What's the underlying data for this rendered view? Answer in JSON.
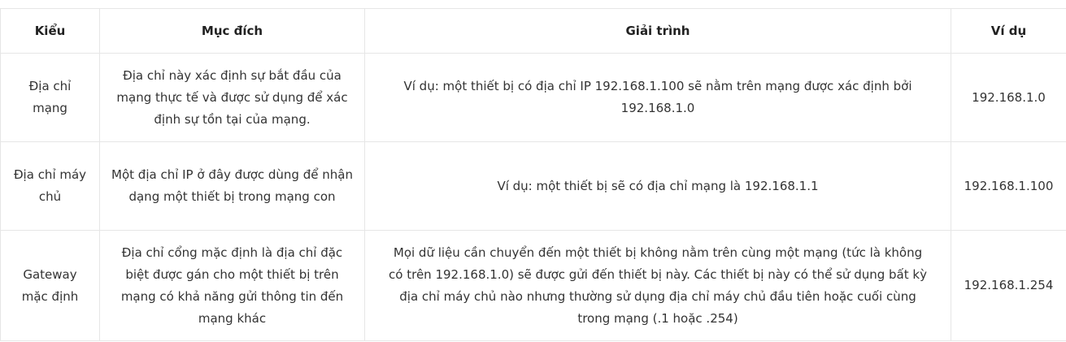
{
  "table": {
    "headers": [
      "Kiểu",
      "Mục đích",
      "Giải trình",
      "Ví dụ"
    ],
    "rows": [
      {
        "type": "Địa chỉ mạng",
        "purpose": "Địa chỉ này xác định sự bắt đầu của mạng thực tế và được sử dụng để xác định sự tồn tại của mạng.",
        "explanation": "Ví dụ: một thiết bị có địa chỉ IP 192.168.1.100 sẽ nằm trên mạng được xác định bởi 192.168.1.0",
        "example": "192.168.1.0"
      },
      {
        "type": "Địa chỉ máy chủ",
        "purpose": "Một địa chỉ IP ở đây được dùng để nhận dạng một thiết bị trong mạng con",
        "explanation": "Ví dụ: một thiết bị sẽ có địa chỉ mạng là 192.168.1.1",
        "example": "192.168.1.100"
      },
      {
        "type": "Gateway mặc định",
        "purpose": "Địa chỉ cổng mặc định là địa chỉ đặc biệt được gán cho một thiết bị trên mạng có khả năng gửi thông tin đến mạng khác",
        "explanation": "Mọi dữ liệu cần chuyển đến một thiết bị không nằm trên cùng một mạng (tức là không có trên 192.168.1.0) sẽ được gửi đến thiết bị này. Các thiết bị này có thể sử dụng bất kỳ địa chỉ máy chủ nào nhưng thường sử dụng địa chỉ máy chủ đầu tiên hoặc cuối cùng trong mạng (.1 hoặc .254)",
        "example": "192.168.1.254"
      }
    ]
  }
}
